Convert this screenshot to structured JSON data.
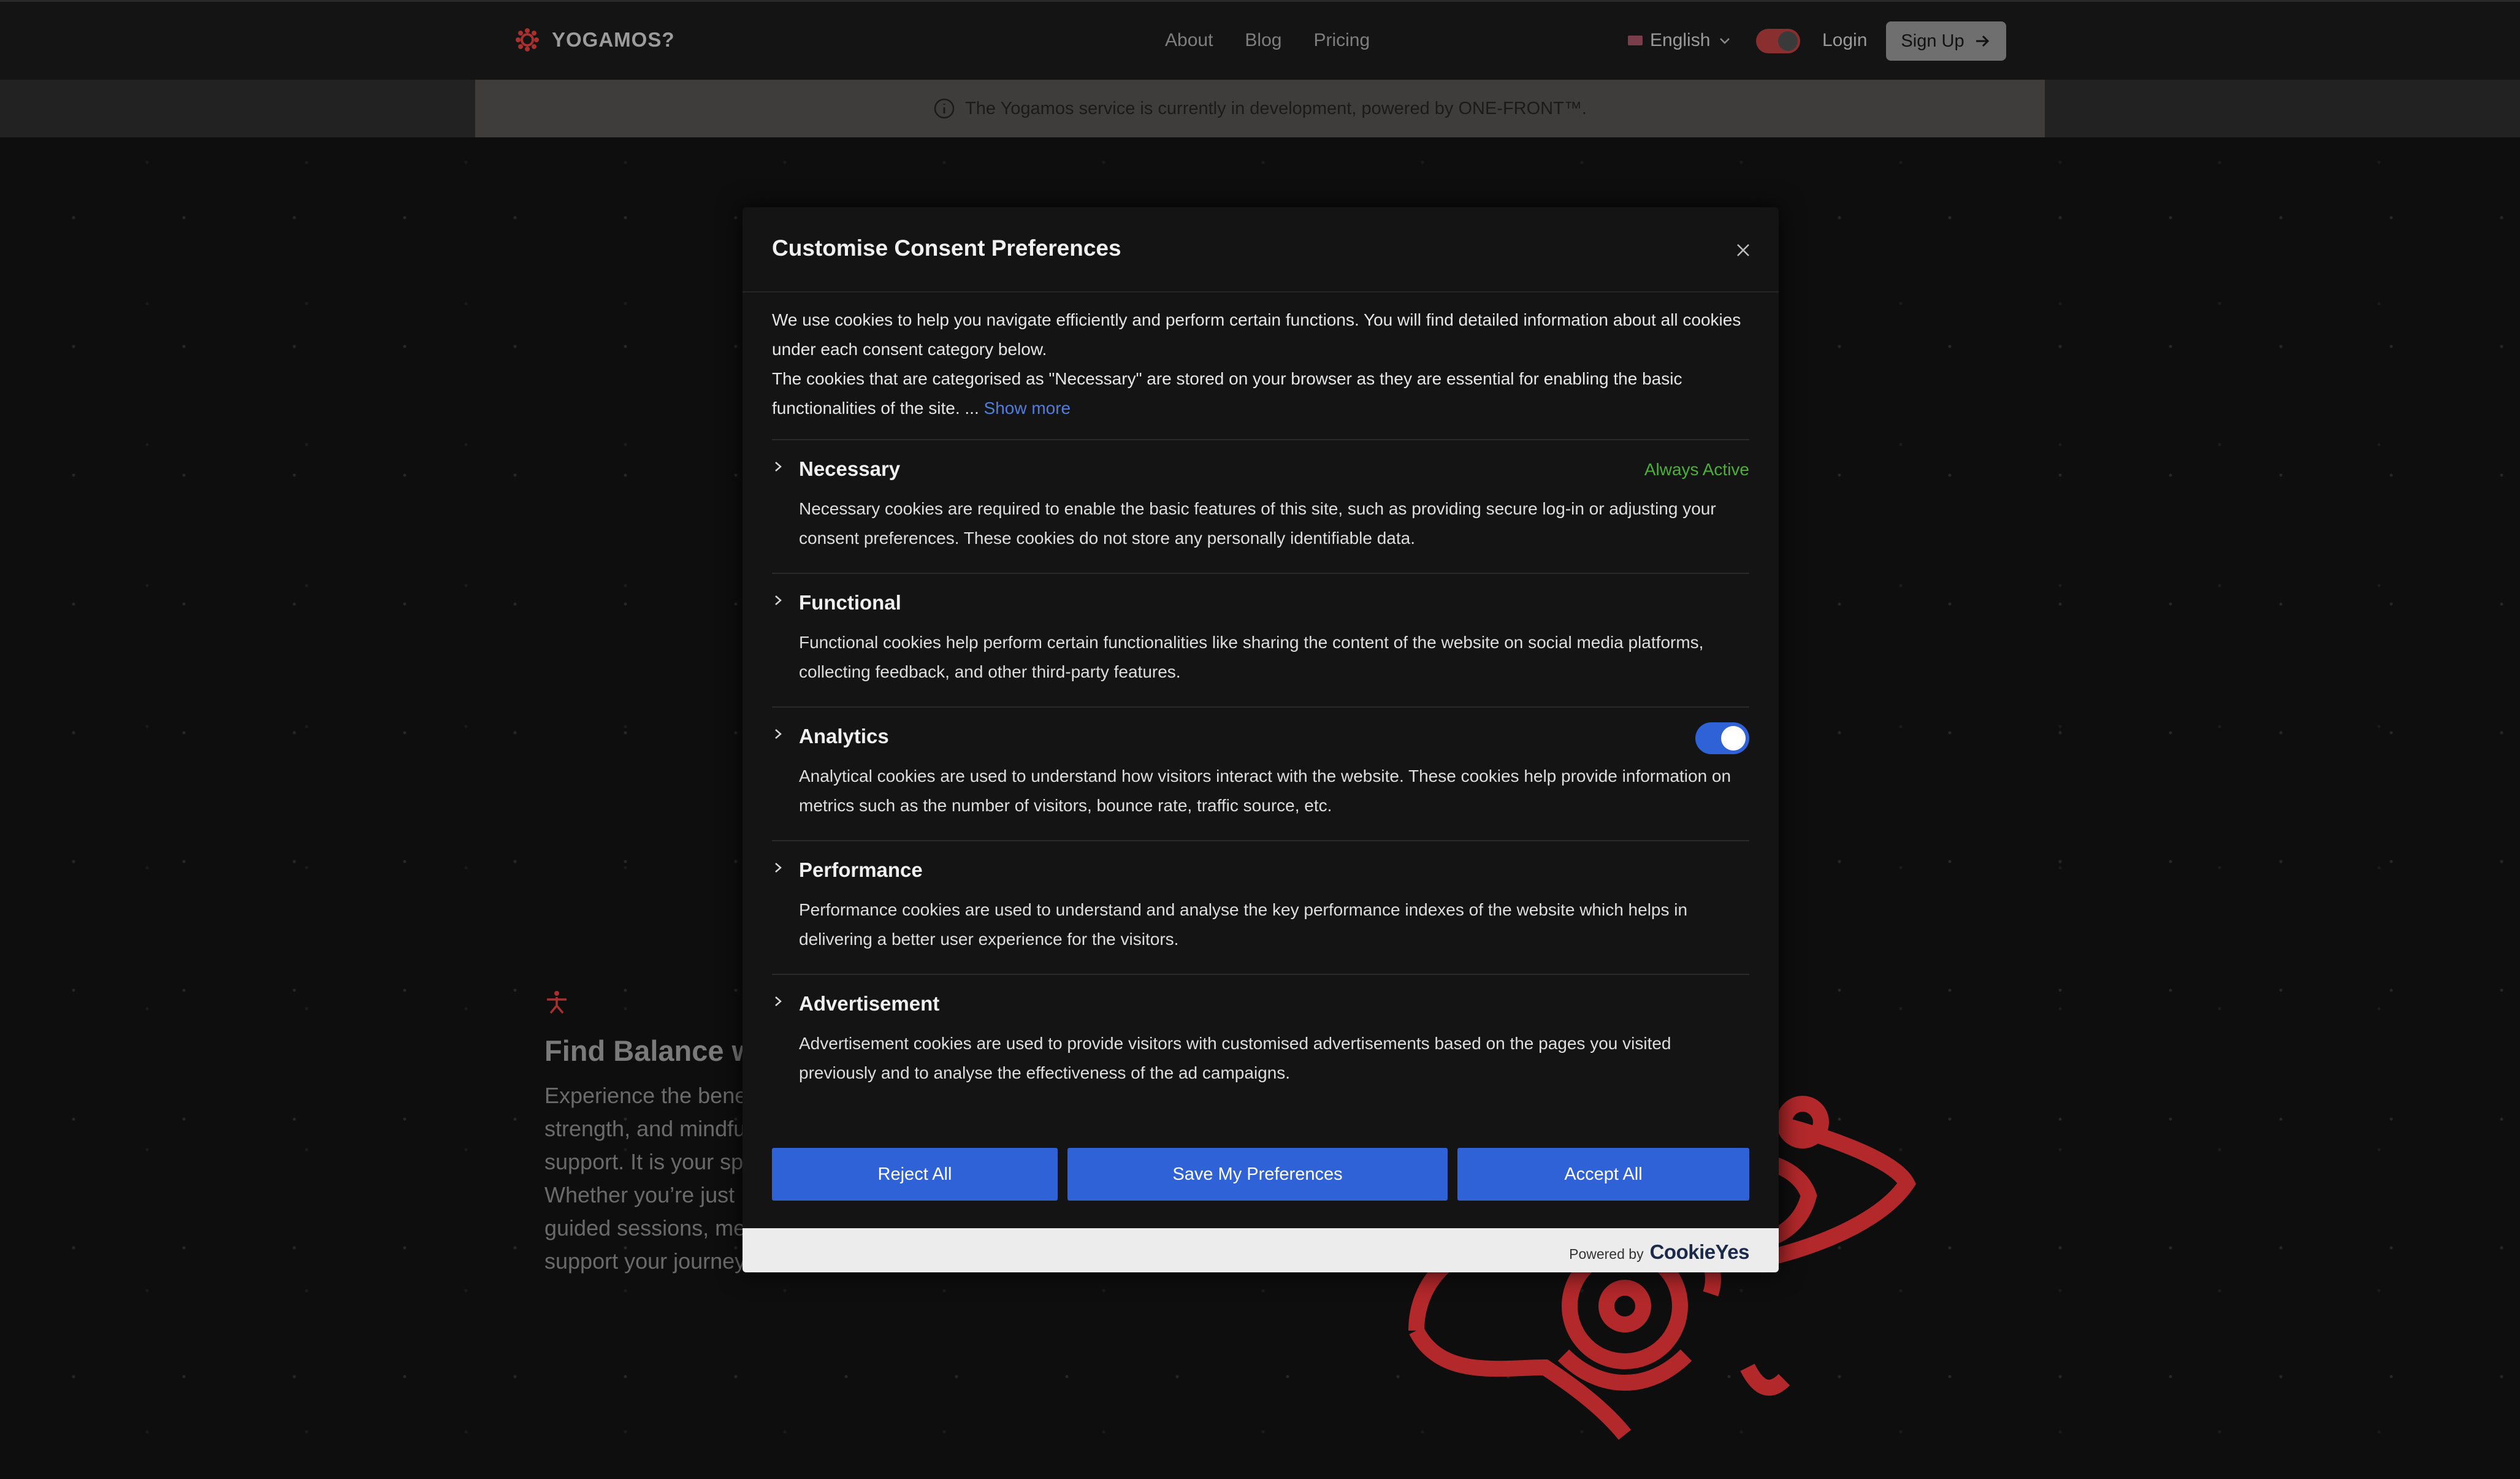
{
  "site": {
    "brand": "YOGAMOS?",
    "nav": [
      "About",
      "Blog",
      "Pricing"
    ],
    "language": "English",
    "login": "Login",
    "signup": "Sign Up",
    "banner": "The Yogamos service is currently in development, powered by ONE-FRONT™."
  },
  "hero": {
    "title": "Find Balance w",
    "body": [
      "Experience the bene",
      "strength, and mindfu",
      "support. It is your sp",
      "Whether you’re just",
      "guided sessions, me",
      "support your journey"
    ]
  },
  "modal": {
    "title": "Customise Consent Preferences",
    "intro1": "We use cookies to help you navigate efficiently and perform certain functions. You will find detailed information about all cookies under each consent category below.",
    "intro2": "The cookies that are categorised as \"Necessary\" are stored on your browser as they are essential for enabling the basic functionalities of the site. ... ",
    "show_more": "Show more",
    "categories": [
      {
        "title": "Necessary",
        "status": "Always Active",
        "desc": "Necessary cookies are required to enable the basic features of this site, such as providing secure log-in or adjusting your consent preferences. These cookies do not store any personally identifiable data."
      },
      {
        "title": "Functional",
        "desc": "Functional cookies help perform certain functionalities like sharing the content of the website on social media platforms, collecting feedback, and other third-party features."
      },
      {
        "title": "Analytics",
        "enabled": true,
        "desc": "Analytical cookies are used to understand how visitors interact with the website. These cookies help provide information on metrics such as the number of visitors, bounce rate, traffic source, etc."
      },
      {
        "title": "Performance",
        "desc": "Performance cookies are used to understand and analyse the key performance indexes of the website which helps in delivering a better user experience for the visitors."
      },
      {
        "title": "Advertisement",
        "desc": "Advertisement cookies are used to provide visitors with customised advertisements based on the pages you visited previously and to analyse the effectiveness of the ad campaigns."
      }
    ],
    "buttons": {
      "reject": "Reject All",
      "save": "Save My Preferences",
      "accept": "Accept All"
    },
    "powered_by": "Powered by",
    "powered_logo": "CookieYes"
  },
  "colors": {
    "accent": "#2f62d6",
    "active_green": "#4caf39",
    "brand_red": "#c0282d"
  }
}
